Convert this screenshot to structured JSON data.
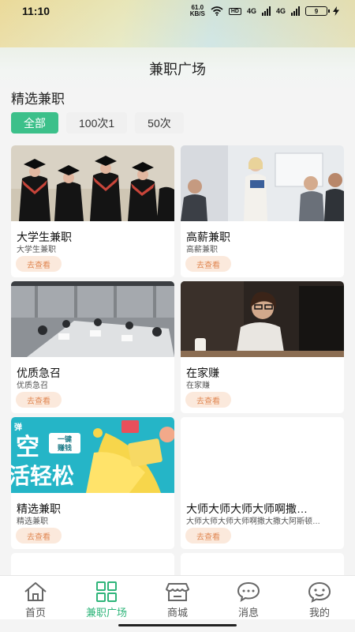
{
  "status": {
    "time": "11:10",
    "speed_value": "61.0",
    "speed_unit": "KB/S",
    "hd": "HD",
    "network1": "4G",
    "network2": "4G",
    "battery": "9"
  },
  "header": {
    "title": "兼职广场"
  },
  "section": {
    "title": "精选兼职"
  },
  "filters": [
    {
      "label": "全部",
      "active": true
    },
    {
      "label": "100次1",
      "active": false
    },
    {
      "label": "50次",
      "active": false
    }
  ],
  "cards": [
    {
      "title": "大学生兼职",
      "subtitle": "大学生兼职",
      "button": "去查看",
      "image": "graduates-photo"
    },
    {
      "title": "高薪兼职",
      "subtitle": "高薪兼职",
      "button": "去查看",
      "image": "presentation-photo"
    },
    {
      "title": "优质急召",
      "subtitle": "优质急召",
      "button": "去查看",
      "image": "office-photo"
    },
    {
      "title": "在家赚",
      "subtitle": "在家赚",
      "button": "去查看",
      "image": "woman-laptop-photo"
    },
    {
      "title": "精选兼职",
      "subtitle": "精选兼职",
      "button": "去查看",
      "image": "promo-banner",
      "banner_text_1": "弹",
      "banner_text_2": "空",
      "banner_text_3": "一键",
      "banner_text_4": "赚钱",
      "banner_text_5": "活轻松"
    },
    {
      "title": "大师大师大师大师啊撒…",
      "subtitle": "大师大师大师大师啊撒大撒大阿斯顿…",
      "button": "去查看",
      "image": "blank"
    }
  ],
  "tabbar": [
    {
      "label": "首页",
      "icon": "home-icon",
      "active": false
    },
    {
      "label": "兼职广场",
      "icon": "grid-icon",
      "active": true
    },
    {
      "label": "商城",
      "icon": "store-icon",
      "active": false
    },
    {
      "label": "消息",
      "icon": "chat-icon",
      "active": false
    },
    {
      "label": "我的",
      "icon": "profile-icon",
      "active": false
    }
  ],
  "colors": {
    "accent": "#3cc08a",
    "tab_active": "#2fb57a",
    "button_bg": "#fbe9dc",
    "button_text": "#e08752"
  }
}
